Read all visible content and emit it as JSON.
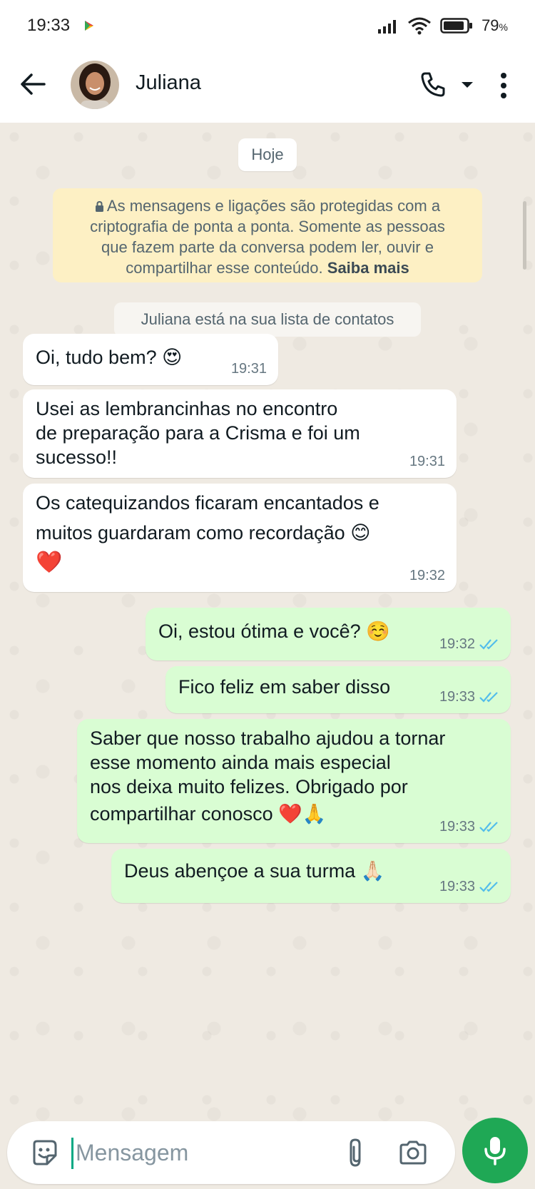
{
  "status_bar": {
    "time": "19:33",
    "battery": "79",
    "battery_unit": "%"
  },
  "header": {
    "contact_name": "Juliana"
  },
  "chat": {
    "date_chip": "Hoje",
    "encryption_line1": "As mensagens e ligações são protegidas com a",
    "encryption_line2": "criptografia de ponta a ponta. Somente as pessoas",
    "encryption_line3": "que fazem parte da conversa podem ler, ouvir e",
    "encryption_line4": "compartilhar esse conteúdo.",
    "encryption_link": "Saiba mais",
    "contact_notice": "Juliana está na sua lista de contatos",
    "messages": [
      {
        "direction": "in",
        "lines": [
          "Oi, tudo bem? 😍"
        ],
        "time": "19:31"
      },
      {
        "direction": "in",
        "lines": [
          "Usei as lembrancinhas no encontro",
          "de preparação para a Crisma e foi um",
          "sucesso!!"
        ],
        "time": "19:31"
      },
      {
        "direction": "in",
        "lines": [
          "Os catequizandos ficaram encantados e",
          "muitos guardaram como recordação 😊",
          "❤️"
        ],
        "time": "19:32"
      },
      {
        "direction": "out",
        "lines": [
          "Oi, estou ótima e você? ☺️"
        ],
        "time": "19:32",
        "status": "read"
      },
      {
        "direction": "out",
        "lines": [
          "Fico feliz em saber disso"
        ],
        "time": "19:33",
        "status": "read"
      },
      {
        "direction": "out",
        "lines": [
          "Saber que nosso trabalho ajudou a tornar",
          "esse momento ainda mais especial",
          "nos deixa muito felizes. Obrigado por",
          "compartilhar conosco ❤️🙏"
        ],
        "time": "19:33",
        "status": "read"
      },
      {
        "direction": "out",
        "lines": [
          "Deus abençoe a sua turma 🙏🏻"
        ],
        "time": "19:33",
        "status": "read"
      }
    ]
  },
  "composer": {
    "placeholder": "Mensagem"
  },
  "colors": {
    "incoming_bubble": "#ffffff",
    "outgoing_bubble": "#d9fdd3",
    "read_ticks": "#53bdeb",
    "mic_button": "#1fa855",
    "chat_background": "#efeae2"
  }
}
